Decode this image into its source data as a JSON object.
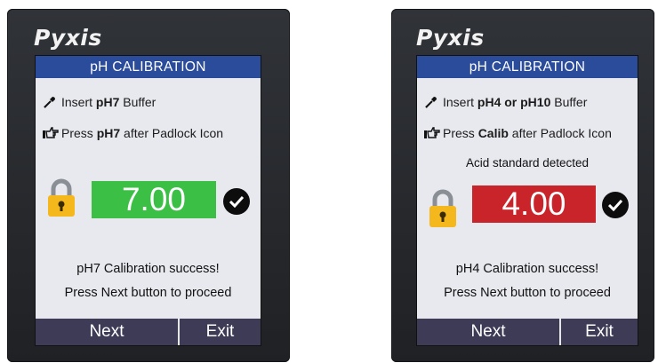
{
  "panels": [
    {
      "brand": "Pyxis",
      "title": "pH CALIBRATION",
      "instr1": {
        "pre": "Insert ",
        "bold": "pH7",
        "post": " Buffer"
      },
      "instr2": {
        "pre": "Press ",
        "bold": "pH7",
        "post": " after Padlock Icon"
      },
      "detect": "",
      "value": "7.00",
      "value_color": "#3bbf45",
      "msg1": "pH7 Calibration success!",
      "msg2": "Press Next button to proceed",
      "next": "Next",
      "exit": "Exit"
    },
    {
      "brand": "Pyxis",
      "title": "pH CALIBRATION",
      "instr1": {
        "pre": "Insert ",
        "bold": "pH4 or pH10",
        "post": " Buffer"
      },
      "instr2": {
        "pre": "Press ",
        "bold": "Calib",
        "post": " after Padlock Icon"
      },
      "detect": "Acid standard detected",
      "value": "4.00",
      "value_color": "#c8242a",
      "msg1": "pH4 Calibration success!",
      "msg2": "Press Next button to proceed",
      "next": "Next",
      "exit": "Exit"
    }
  ],
  "icons": {
    "instr1": "dropper-icon",
    "instr2": "pointing-hand-icon",
    "lock": "padlock-icon",
    "check": "checkmark-icon"
  },
  "colors": {
    "titlebar": "#2b4b9b",
    "footer": "#3d3b55",
    "screen": "#e8e9ee",
    "padlock": "#f5b81c"
  }
}
